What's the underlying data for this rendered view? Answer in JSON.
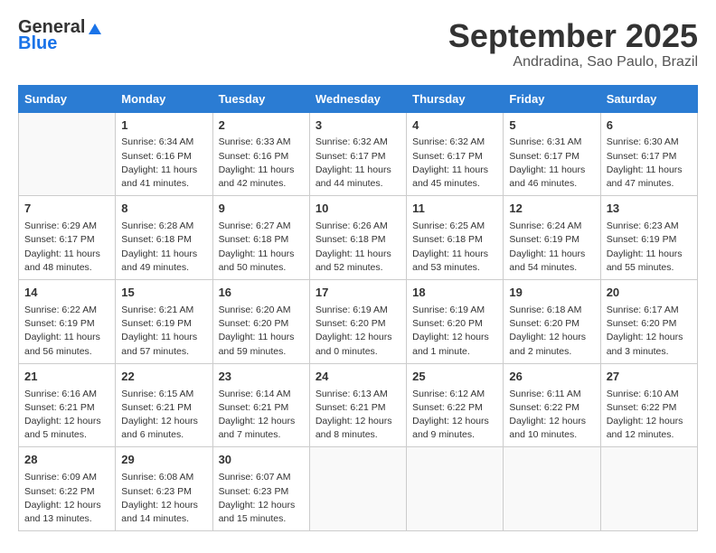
{
  "header": {
    "logo_line1": "General",
    "logo_line2": "Blue",
    "month": "September 2025",
    "location": "Andradina, Sao Paulo, Brazil"
  },
  "days_of_week": [
    "Sunday",
    "Monday",
    "Tuesday",
    "Wednesday",
    "Thursday",
    "Friday",
    "Saturday"
  ],
  "weeks": [
    [
      {
        "day": "",
        "sunrise": "",
        "sunset": "",
        "daylight": ""
      },
      {
        "day": "1",
        "sunrise": "Sunrise: 6:34 AM",
        "sunset": "Sunset: 6:16 PM",
        "daylight": "Daylight: 11 hours and 41 minutes."
      },
      {
        "day": "2",
        "sunrise": "Sunrise: 6:33 AM",
        "sunset": "Sunset: 6:16 PM",
        "daylight": "Daylight: 11 hours and 42 minutes."
      },
      {
        "day": "3",
        "sunrise": "Sunrise: 6:32 AM",
        "sunset": "Sunset: 6:17 PM",
        "daylight": "Daylight: 11 hours and 44 minutes."
      },
      {
        "day": "4",
        "sunrise": "Sunrise: 6:32 AM",
        "sunset": "Sunset: 6:17 PM",
        "daylight": "Daylight: 11 hours and 45 minutes."
      },
      {
        "day": "5",
        "sunrise": "Sunrise: 6:31 AM",
        "sunset": "Sunset: 6:17 PM",
        "daylight": "Daylight: 11 hours and 46 minutes."
      },
      {
        "day": "6",
        "sunrise": "Sunrise: 6:30 AM",
        "sunset": "Sunset: 6:17 PM",
        "daylight": "Daylight: 11 hours and 47 minutes."
      }
    ],
    [
      {
        "day": "7",
        "sunrise": "Sunrise: 6:29 AM",
        "sunset": "Sunset: 6:17 PM",
        "daylight": "Daylight: 11 hours and 48 minutes."
      },
      {
        "day": "8",
        "sunrise": "Sunrise: 6:28 AM",
        "sunset": "Sunset: 6:18 PM",
        "daylight": "Daylight: 11 hours and 49 minutes."
      },
      {
        "day": "9",
        "sunrise": "Sunrise: 6:27 AM",
        "sunset": "Sunset: 6:18 PM",
        "daylight": "Daylight: 11 hours and 50 minutes."
      },
      {
        "day": "10",
        "sunrise": "Sunrise: 6:26 AM",
        "sunset": "Sunset: 6:18 PM",
        "daylight": "Daylight: 11 hours and 52 minutes."
      },
      {
        "day": "11",
        "sunrise": "Sunrise: 6:25 AM",
        "sunset": "Sunset: 6:18 PM",
        "daylight": "Daylight: 11 hours and 53 minutes."
      },
      {
        "day": "12",
        "sunrise": "Sunrise: 6:24 AM",
        "sunset": "Sunset: 6:19 PM",
        "daylight": "Daylight: 11 hours and 54 minutes."
      },
      {
        "day": "13",
        "sunrise": "Sunrise: 6:23 AM",
        "sunset": "Sunset: 6:19 PM",
        "daylight": "Daylight: 11 hours and 55 minutes."
      }
    ],
    [
      {
        "day": "14",
        "sunrise": "Sunrise: 6:22 AM",
        "sunset": "Sunset: 6:19 PM",
        "daylight": "Daylight: 11 hours and 56 minutes."
      },
      {
        "day": "15",
        "sunrise": "Sunrise: 6:21 AM",
        "sunset": "Sunset: 6:19 PM",
        "daylight": "Daylight: 11 hours and 57 minutes."
      },
      {
        "day": "16",
        "sunrise": "Sunrise: 6:20 AM",
        "sunset": "Sunset: 6:20 PM",
        "daylight": "Daylight: 11 hours and 59 minutes."
      },
      {
        "day": "17",
        "sunrise": "Sunrise: 6:19 AM",
        "sunset": "Sunset: 6:20 PM",
        "daylight": "Daylight: 12 hours and 0 minutes."
      },
      {
        "day": "18",
        "sunrise": "Sunrise: 6:19 AM",
        "sunset": "Sunset: 6:20 PM",
        "daylight": "Daylight: 12 hours and 1 minute."
      },
      {
        "day": "19",
        "sunrise": "Sunrise: 6:18 AM",
        "sunset": "Sunset: 6:20 PM",
        "daylight": "Daylight: 12 hours and 2 minutes."
      },
      {
        "day": "20",
        "sunrise": "Sunrise: 6:17 AM",
        "sunset": "Sunset: 6:20 PM",
        "daylight": "Daylight: 12 hours and 3 minutes."
      }
    ],
    [
      {
        "day": "21",
        "sunrise": "Sunrise: 6:16 AM",
        "sunset": "Sunset: 6:21 PM",
        "daylight": "Daylight: 12 hours and 5 minutes."
      },
      {
        "day": "22",
        "sunrise": "Sunrise: 6:15 AM",
        "sunset": "Sunset: 6:21 PM",
        "daylight": "Daylight: 12 hours and 6 minutes."
      },
      {
        "day": "23",
        "sunrise": "Sunrise: 6:14 AM",
        "sunset": "Sunset: 6:21 PM",
        "daylight": "Daylight: 12 hours and 7 minutes."
      },
      {
        "day": "24",
        "sunrise": "Sunrise: 6:13 AM",
        "sunset": "Sunset: 6:21 PM",
        "daylight": "Daylight: 12 hours and 8 minutes."
      },
      {
        "day": "25",
        "sunrise": "Sunrise: 6:12 AM",
        "sunset": "Sunset: 6:22 PM",
        "daylight": "Daylight: 12 hours and 9 minutes."
      },
      {
        "day": "26",
        "sunrise": "Sunrise: 6:11 AM",
        "sunset": "Sunset: 6:22 PM",
        "daylight": "Daylight: 12 hours and 10 minutes."
      },
      {
        "day": "27",
        "sunrise": "Sunrise: 6:10 AM",
        "sunset": "Sunset: 6:22 PM",
        "daylight": "Daylight: 12 hours and 12 minutes."
      }
    ],
    [
      {
        "day": "28",
        "sunrise": "Sunrise: 6:09 AM",
        "sunset": "Sunset: 6:22 PM",
        "daylight": "Daylight: 12 hours and 13 minutes."
      },
      {
        "day": "29",
        "sunrise": "Sunrise: 6:08 AM",
        "sunset": "Sunset: 6:23 PM",
        "daylight": "Daylight: 12 hours and 14 minutes."
      },
      {
        "day": "30",
        "sunrise": "Sunrise: 6:07 AM",
        "sunset": "Sunset: 6:23 PM",
        "daylight": "Daylight: 12 hours and 15 minutes."
      },
      {
        "day": "",
        "sunrise": "",
        "sunset": "",
        "daylight": ""
      },
      {
        "day": "",
        "sunrise": "",
        "sunset": "",
        "daylight": ""
      },
      {
        "day": "",
        "sunrise": "",
        "sunset": "",
        "daylight": ""
      },
      {
        "day": "",
        "sunrise": "",
        "sunset": "",
        "daylight": ""
      }
    ]
  ]
}
